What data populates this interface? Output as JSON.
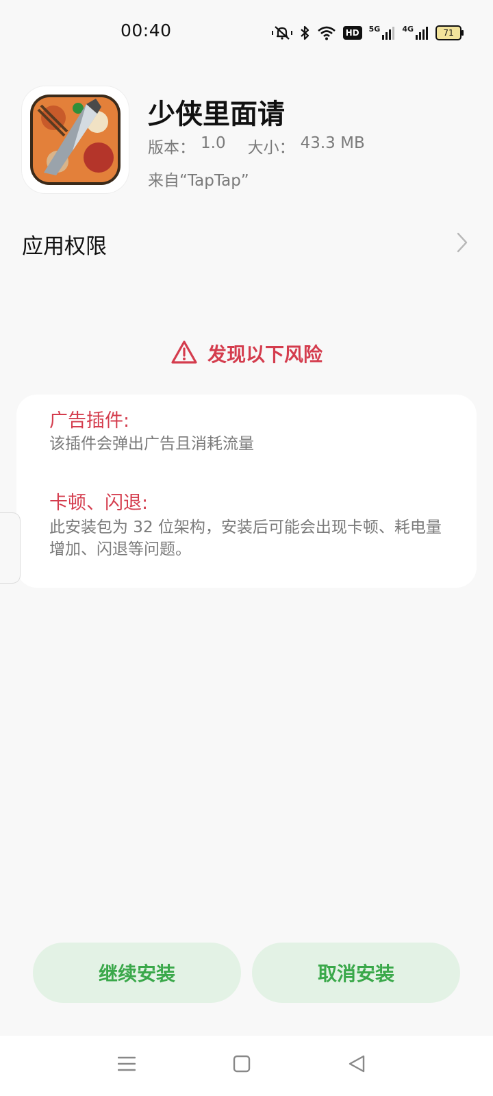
{
  "status_bar": {
    "time": "00:40",
    "hd_label": "HD",
    "net_5g": "5G",
    "net_4g": "4G",
    "battery": "71"
  },
  "app": {
    "name": "少侠里面请",
    "version_label": "版本：",
    "version": "1.0",
    "size_label": "大小：",
    "size": "43.3 MB",
    "source": "来自“TapTap”"
  },
  "permissions": {
    "label": "应用权限"
  },
  "risk": {
    "title": "发现以下风险",
    "items": [
      {
        "title": "广告插件:",
        "desc": "该插件会弹出广告且消耗流量"
      },
      {
        "title": "卡顿、闪退:",
        "desc": "此安装包为 32 位架构，安装后可能会出现卡顿、耗电量增加、闪退等问题。"
      }
    ]
  },
  "buttons": {
    "continue": "继续安装",
    "cancel": "取消安装"
  },
  "icons": {
    "mute": "mute-vibrate-icon",
    "bluetooth": "bluetooth-icon",
    "wifi": "wifi-icon",
    "signal": "signal-icon",
    "chevron": "chevron-right-icon",
    "warning": "warning-triangle-icon",
    "nav_menu": "menu-icon",
    "nav_home": "home-icon",
    "nav_back": "back-icon"
  },
  "colors": {
    "risk_red": "#d43c4d",
    "button_green": "#3aa84a",
    "button_bg": "#e3f2e5"
  }
}
